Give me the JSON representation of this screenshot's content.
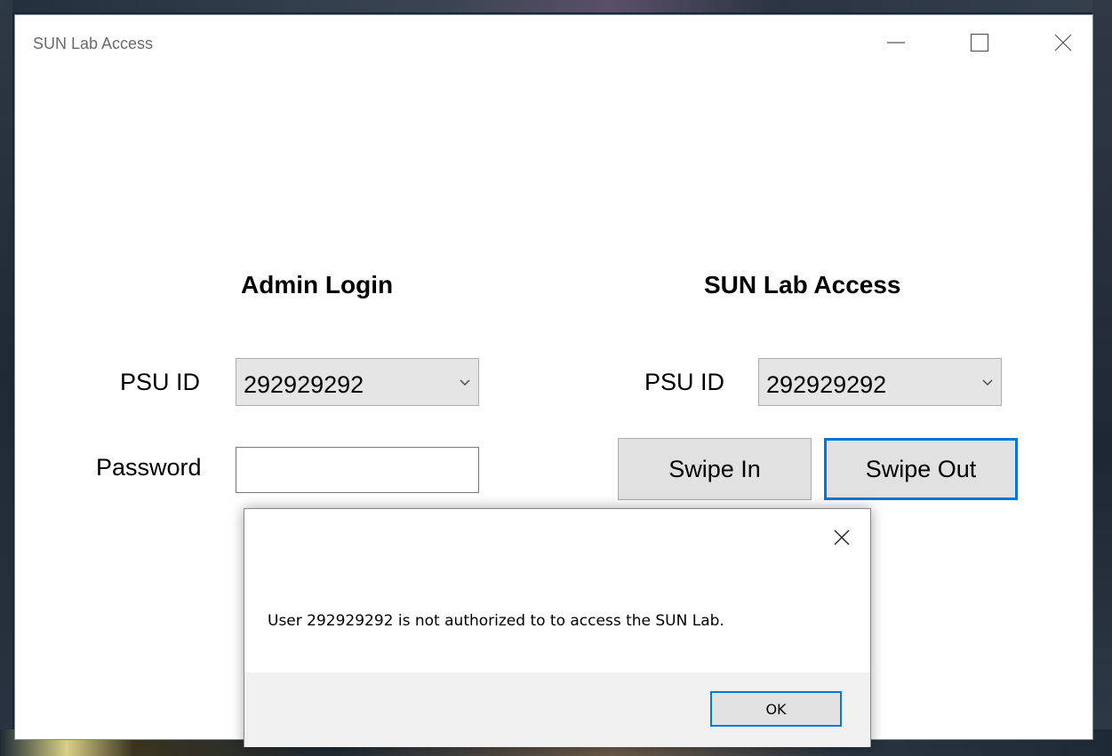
{
  "window": {
    "title": "SUN Lab Access"
  },
  "admin": {
    "heading": "Admin Login",
    "psu_label": "PSU ID",
    "psu_value": "292929292",
    "password_label": "Password",
    "password_value": ""
  },
  "access": {
    "heading": "SUN Lab Access",
    "psu_label": "PSU ID",
    "psu_value": "292929292",
    "swipe_in_label": "Swipe In",
    "swipe_out_label": "Swipe Out"
  },
  "dialog": {
    "message": "User 292929292 is not authorized to to access the SUN Lab.",
    "ok_label": "OK"
  },
  "colors": {
    "focus_accent": "#0078d7"
  }
}
